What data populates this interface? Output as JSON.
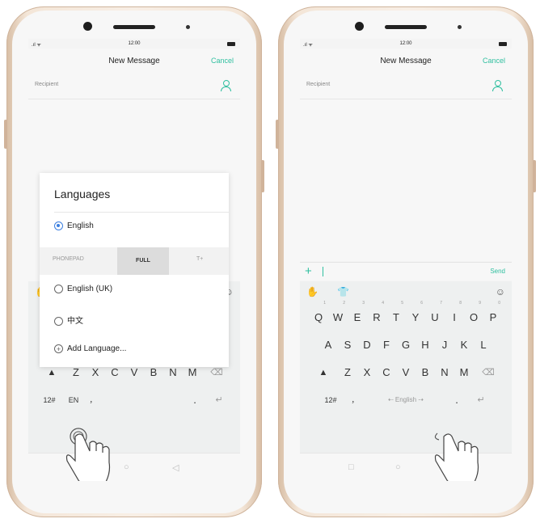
{
  "colors": {
    "accent": "#2fbf9f",
    "radio_selected": "#3c7fe0"
  },
  "status": {
    "time": "12:00",
    "signal": ".ıl ᯤ"
  },
  "header": {
    "title": "New Message",
    "cancel": "Cancel"
  },
  "recipient": {
    "label": "Recipient",
    "icon": "add-contact-icon"
  },
  "compose": {
    "plus": "+",
    "send": "Send"
  },
  "popup": {
    "title": "Languages",
    "selected": "English",
    "layouts": [
      "PHONEPAD",
      "FULL",
      "T+"
    ],
    "selected_layout": "FULL",
    "options": [
      "English (UK)",
      "中文"
    ],
    "add": "Add Language..."
  },
  "toolbar": {
    "left_icon": "hand-icon",
    "mid_icon": "shirt-icon",
    "right_icon": "emoji-icon"
  },
  "keyboard": {
    "row1": [
      "Q",
      "W",
      "E",
      "R",
      "T",
      "Y",
      "U",
      "I",
      "O",
      "P"
    ],
    "row1_nums": [
      "1",
      "2",
      "3",
      "4",
      "5",
      "6",
      "7",
      "8",
      "9",
      "0"
    ],
    "row2": [
      "A",
      "S",
      "D",
      "F",
      "G",
      "H",
      "J",
      "K",
      "L"
    ],
    "row3": [
      "Z",
      "X",
      "C",
      "V",
      "B",
      "N",
      "M"
    ],
    "shift": "▲",
    "backspace": "⌫",
    "num_key": "12#",
    "lang_key": "EN",
    "comma": "，",
    "mic": "🎙",
    "dot": ".",
    "enter": "↵",
    "space_label": "English"
  },
  "nav": {
    "square": "□",
    "circle": "○",
    "back": "◁"
  }
}
